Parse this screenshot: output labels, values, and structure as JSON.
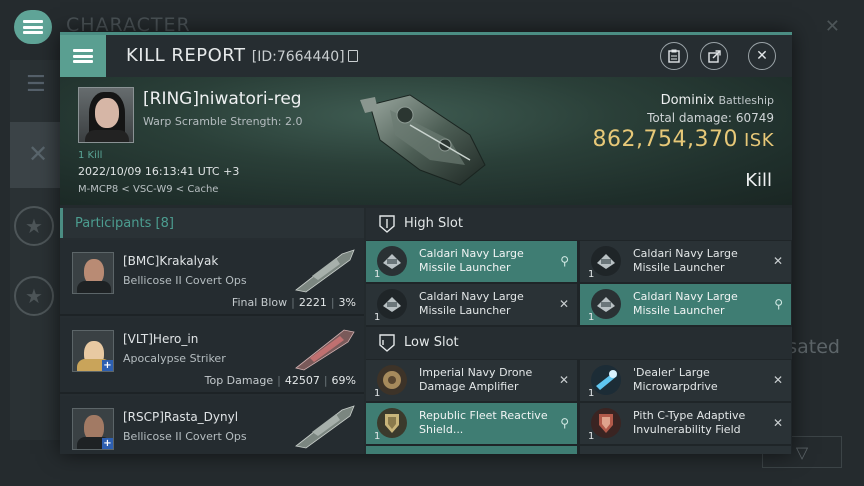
{
  "background": {
    "title": "CHARACTER",
    "right_text": "esated"
  },
  "header": {
    "title": "KILL REPORT",
    "id_label": "[ID:7664440]"
  },
  "victim": {
    "name": "[RING]niwatori-reg",
    "warp_scramble": "Warp Scramble Strength: 2.0",
    "kills_link": "1 Kill",
    "date": "2022/10/09 16:13:41 UTC +3",
    "location": "M-MCP8 < VSC-W9 < Cache",
    "ship_name": "Dominix",
    "ship_class": "Battleship",
    "total_damage_label": "Total damage:",
    "total_damage": "60749",
    "isk_value": "862,754,370",
    "isk_unit": "ISK",
    "result": "Kill"
  },
  "participants": {
    "title": "Participants [8]",
    "rows": [
      {
        "name": "[BMC]Krakalyak",
        "ship": "Bellicose II Covert Ops",
        "stat_label": "Final Blow",
        "damage": "2221",
        "percent": "3%"
      },
      {
        "name": "[VLT]Hero_in",
        "ship": "Apocalypse Striker",
        "stat_label": "Top Damage",
        "damage": "42507",
        "percent": "69%"
      },
      {
        "name": "[RSCP]Rasta_Dynyl",
        "ship": "Bellicose II Covert Ops",
        "stat_label": "",
        "damage": "",
        "percent": ""
      }
    ]
  },
  "fitting": {
    "high_slot_title": "High Slot",
    "low_slot_title": "Low Slot",
    "high": [
      {
        "qty": "1",
        "name": "Caldari Navy Large Missile Launcher",
        "state": "dropped"
      },
      {
        "qty": "1",
        "name": "Caldari Navy Large Missile Launcher",
        "state": "destroyed"
      },
      {
        "qty": "1",
        "name": "Caldari Navy Large Missile Launcher",
        "state": "destroyed"
      },
      {
        "qty": "1",
        "name": "Caldari Navy Large Missile Launcher",
        "state": "dropped"
      }
    ],
    "low": [
      {
        "qty": "1",
        "name": "Imperial Navy Drone Damage Amplifier",
        "state": "destroyed"
      },
      {
        "qty": "1",
        "name": "'Dealer' Large Microwarpdrive",
        "state": "destroyed"
      },
      {
        "qty": "1",
        "name": "Republic Fleet Reactive Shield...",
        "state": "dropped"
      },
      {
        "qty": "1",
        "name": "Pith C-Type Adaptive Invulnerability Field",
        "state": "destroyed"
      }
    ]
  },
  "colors": {
    "accent": "#5a9f91",
    "isk": "#e7c878",
    "dropped_bg": "#3f7d73"
  }
}
